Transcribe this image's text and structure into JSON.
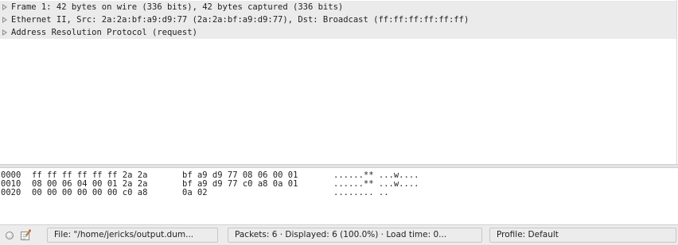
{
  "packet_details": {
    "rows": [
      "Frame 1: 42 bytes on wire (336 bits), 42 bytes captured (336 bits)",
      "Ethernet II, Src: 2a:2a:bf:a9:d9:77 (2a:2a:bf:a9:d9:77), Dst: Broadcast (ff:ff:ff:ff:ff:ff)",
      "Address Resolution Protocol (request)"
    ]
  },
  "hex_dump": {
    "rows": [
      {
        "offset": "0000",
        "bytes1": "ff ff ff ff ff ff 2a 2a",
        "bytes2": "bf a9 d9 77 08 06 00 01",
        "ascii": "......** ...w...."
      },
      {
        "offset": "0010",
        "bytes1": "08 00 06 04 00 01 2a 2a",
        "bytes2": "bf a9 d9 77 c0 a8 0a 01",
        "ascii": "......** ...w...."
      },
      {
        "offset": "0020",
        "bytes1": "00 00 00 00 00 00 c0 a8",
        "bytes2": "0a 02",
        "ascii": "........ .."
      }
    ]
  },
  "status_bar": {
    "file": "File: \"/home/jericks/output.dum...",
    "packets": "Packets: 6 · Displayed: 6 (100.0%)  · Load time: 0...",
    "profile": "Profile: Default",
    "icons": [
      "expert-info-icon",
      "capture-comment-icon"
    ]
  }
}
